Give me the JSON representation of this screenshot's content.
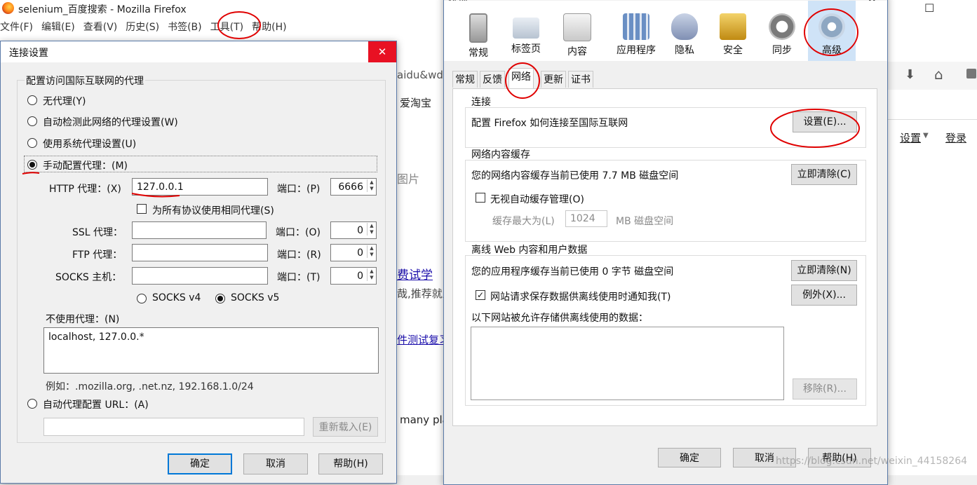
{
  "firefox": {
    "title": "selenium_百度搜索 - Mozilla Firefox",
    "menu": [
      "文件(F)",
      "编辑(E)",
      "查看(V)",
      "历史(S)",
      "书签(B)",
      "工具(T)",
      "帮助(H)"
    ],
    "controls": {
      "minimize": "—",
      "maximize": "☐",
      "close": "✕"
    },
    "page_fragments": {
      "url_fragment": "aidu&wd",
      "bookmark_item": "爱淘宝",
      "settings_link": "设置",
      "login_link": "登录",
      "images_tab": "图片",
      "result_link": "费试学",
      "result_snippet": "哉,推荐就业",
      "result_link2": "件测试复习",
      "result_text": "many plat"
    }
  },
  "connection_dialog": {
    "title": "连接设置",
    "group_title": "配置访问国际互联网的代理",
    "options": {
      "no_proxy": "无代理(Y)",
      "auto_detect": "自动检测此网络的代理设置(W)",
      "system": "使用系统代理设置(U)",
      "manual": "手动配置代理：(M)",
      "auto_url": "自动代理配置 URL：(A)"
    },
    "selected_option": "manual",
    "http": {
      "label": "HTTP 代理：(X)",
      "value": "127.0.0.1",
      "port_label": "端口：(P)",
      "port": "6666"
    },
    "same_proxy_label": "为所有协议使用相同代理(S)",
    "ssl": {
      "label": "SSL 代理：",
      "value": "",
      "port_label": "端口：(O)",
      "port": "0"
    },
    "ftp": {
      "label": "FTP 代理：",
      "value": "",
      "port_label": "端口：(R)",
      "port": "0"
    },
    "socks": {
      "label": "SOCKS 主机：",
      "value": "",
      "port_label": "端口：(T)",
      "port": "0"
    },
    "socks_v4": "SOCKS v4",
    "socks_v5": "SOCKS v5",
    "no_proxy_label": "不使用代理：(N)",
    "no_proxy_value": "localhost, 127.0.0.*",
    "example": "例如：.mozilla.org, .net.nz, 192.168.1.0/24",
    "auto_url_value": "",
    "reload_button": "重新载入(E)",
    "ok": "确定",
    "cancel": "取消",
    "help": "帮助(H)",
    "close": "✕"
  },
  "options_dialog": {
    "title": "选项",
    "toolbar": [
      "常规",
      "标签页",
      "内容",
      "应用程序",
      "隐私",
      "安全",
      "同步",
      "高级"
    ],
    "selected_toolbar": "高级",
    "tabs": [
      "常规",
      "反馈",
      "网络",
      "更新",
      "证书"
    ],
    "selected_tab": "网络",
    "connection": {
      "title": "连接",
      "desc": "配置 Firefox 如何连接至国际互联网",
      "button": "设置(E)..."
    },
    "cache": {
      "title": "网络内容缓存",
      "desc": "您的网络内容缓存当前已使用 7.7 MB 磁盘空间",
      "clear": "立即清除(C)",
      "override_label": "无视自动缓存管理(O)",
      "limit_label": "缓存最大为(L)",
      "limit_value": "1024",
      "limit_unit": "MB 磁盘空间"
    },
    "offline": {
      "title": "离线 Web 内容和用户数据",
      "desc": "您的应用程序缓存当前已使用 0 字节 磁盘空间",
      "clear": "立即清除(N)",
      "notify_label": "网站请求保存数据供离线使用时通知我(T)",
      "exceptions": "例外(X)...",
      "list_label": "以下网站被允许存储供离线使用的数据：",
      "remove": "移除(R)..."
    },
    "ok": "确定",
    "cancel": "取消",
    "help": "帮助(H)",
    "close": "✕"
  },
  "watermark": "https://blog.csdn.net/weixin_44158264",
  "colors": {
    "annotation": "#e00000",
    "accent": "#0078d7",
    "close_red": "#e81123"
  }
}
